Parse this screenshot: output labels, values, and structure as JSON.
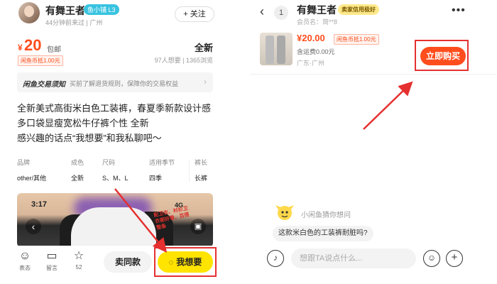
{
  "left": {
    "seller": {
      "name": "有舞王者",
      "level_badge": "鱼小铺 L3",
      "seen": "44分钟前来过 | 广州"
    },
    "follow_label": "+ 关注",
    "price": {
      "currency": "¥",
      "value": "20",
      "shipping": "包邮",
      "coin_tag": "闲鱼币抵1.00元"
    },
    "condition": "全新",
    "stats": "97人想要 | 1365浏览",
    "notice": {
      "title": "闲鱼交易须知",
      "text": "买前了解退货规则，保障你的交易权益",
      "chevron": "›"
    },
    "description": [
      "全新美式高街米白色工装裤，春夏季新款设计感",
      "多口袋显瘦宽松牛仔裤个性  全新",
      "感兴趣的话点“我想要”和我私聊吧～"
    ],
    "attributes": [
      {
        "key": "品牌",
        "value": "other/其他"
      },
      {
        "key": "成色",
        "value": "全新"
      },
      {
        "key": "尺码",
        "value": "S、M、L"
      },
      {
        "key": "适用季节",
        "value": "四季"
      },
      {
        "key": "裤长",
        "value": "长裤"
      }
    ],
    "photo": {
      "time": "3:17",
      "status": "4G",
      "note": "配卫衣、衬衫卫衣都好看、百搭整备"
    },
    "bottom": {
      "items": [
        {
          "icon": "smile-plus-icon",
          "glyph": "☺",
          "label": "表态"
        },
        {
          "icon": "message-icon",
          "glyph": "▭",
          "label": "留言"
        },
        {
          "icon": "star-icon",
          "glyph": "☆",
          "label": "52"
        }
      ],
      "sell_same": "卖同款",
      "want": "我想要",
      "want_icon": "◌"
    }
  },
  "right": {
    "back": "‹",
    "unread": "1",
    "name": "有舞王者",
    "badge": "卖家信用极好",
    "member": "会员名：简**8",
    "more": "•••",
    "item": {
      "price": "¥20.00",
      "coin_tag": "闲鱼币抵1.00元",
      "shipping": "含运费0.00元",
      "location": "广东·广州"
    },
    "buy_label": "立即购买",
    "bot_label": "小闲鱼猜你想问",
    "guess_question": "这款米白色的工装裤耐脏吗?",
    "input_placeholder": "想跟TA说点什么...",
    "voice_glyph": "♪",
    "emoji_glyph": "☺",
    "plus_glyph": "+"
  },
  "colors": {
    "accent": "#ff4d1d",
    "yellow": "#ffe400",
    "annotation_red": "#e53030"
  }
}
